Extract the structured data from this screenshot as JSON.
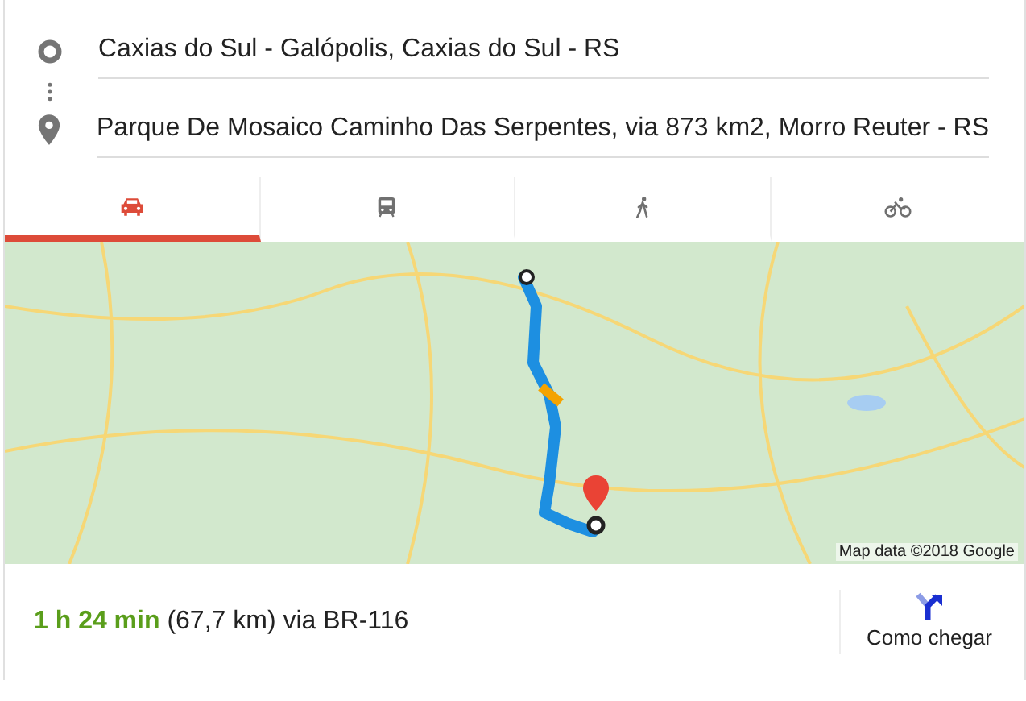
{
  "origin": {
    "value": "Caxias do Sul - Galópolis, Caxias do Sul - RS"
  },
  "destination": {
    "value": "Parque De Mosaico Caminho Das Serpentes, via 873 km2, Morro Reuter - RS"
  },
  "modes": [
    {
      "kind": "car",
      "selected": true
    },
    {
      "kind": "transit",
      "selected": false
    },
    {
      "kind": "walk",
      "selected": false
    },
    {
      "kind": "bike",
      "selected": false
    }
  ],
  "map": {
    "kind": "picture",
    "attribution": "Map data ©2018 Google"
  },
  "summary": {
    "duration": "1 h 24 min",
    "details": "(67,7 km) via BR-116"
  },
  "directions_button": {
    "label": "Como chegar"
  }
}
